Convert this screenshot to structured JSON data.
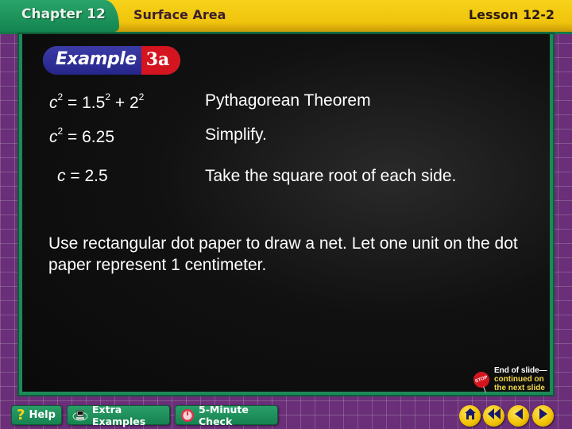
{
  "header": {
    "chapter": "Chapter 12",
    "chapter_title": "Surface Area",
    "lesson": "Lesson 12-2"
  },
  "example": {
    "word": "Example",
    "number": "3a"
  },
  "steps": [
    {
      "lhs_var": "c",
      "lhs_exp": "2",
      "rhs": "= 1.5",
      "rhs_exp1": "2",
      "rhs_mid": " + 2",
      "rhs_exp2": "2",
      "reason": "Pythagorean Theorem"
    },
    {
      "lhs_var": "c",
      "lhs_exp": "2",
      "rhs": "= 6.25",
      "reason": "Simplify."
    },
    {
      "lhs_var": "c",
      "rhs": "= 2.5",
      "reason": "Take the square root of each side."
    }
  ],
  "instruction": "Use rectangular dot paper to draw a net. Let one unit on the dot paper represent 1 centimeter.",
  "end_note": {
    "stop_label": "STOP",
    "line1": "End of slide—",
    "line2": "continued on",
    "line3": "the next slide"
  },
  "nav": {
    "help": "Help",
    "extra_examples": "Extra Examples",
    "five_minute_check": "5-Minute Check",
    "help_icon": "?",
    "home_icon": "home-icon",
    "first_icon": "rewind-icon",
    "prev_icon": "previous-icon",
    "next_icon": "next-icon"
  },
  "colors": {
    "header_yellow": "#f0c40c",
    "chapter_green": "#138550",
    "background_purple": "#6a2f78",
    "example_blue": "#25258a",
    "example_red": "#d4141e"
  }
}
